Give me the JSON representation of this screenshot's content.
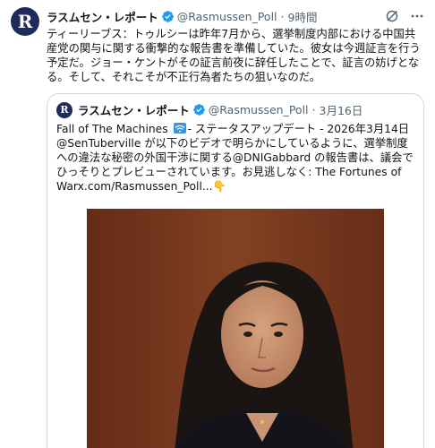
{
  "tweet": {
    "display_name": "ラスムセン・レポート",
    "handle": "@Rasmussen_Poll",
    "time": "9時間",
    "text": "ティーリーブス：トゥルシーは昨年7月から、選挙制度内部における中国共産党の関与に関する衝撃的な報告書を準備していた。彼女は今週証言を行う予定だ。ジョー・ケントがその証言前夜に辞任したことで、証言の妨げとなる。そして、それこそが不正行為者たちの狙いなのだ。"
  },
  "quote": {
    "display_name": "ラスムセン・レポート",
    "handle": "@Rasmussen_Poll",
    "date": "3月16日",
    "text_part1": "Fall of The Machines ",
    "text_part2": "- ステータスアップデート - 2026年3月14日@SenTuberville が以下のビデオで明らかにしているように、選挙制度への違法な秘密の外国干渉に関する@DNIGabbard の報告書は、議会でひっそりとプレビューされています。お見逃しなく: The Fortunes of Warx.com/Rasmussen_Poll...",
    "pointing_emoji": "👇"
  },
  "colors": {
    "brand_navy": "#1f2b5b",
    "verified_blue": "#1d9bf0",
    "muted": "#536471",
    "border": "#cfd9de"
  },
  "icons": {
    "verified": "verified-badge-icon",
    "grok": "grok-icon",
    "more": "more-options-icon",
    "wifi": "wifi-emoji-icon"
  }
}
